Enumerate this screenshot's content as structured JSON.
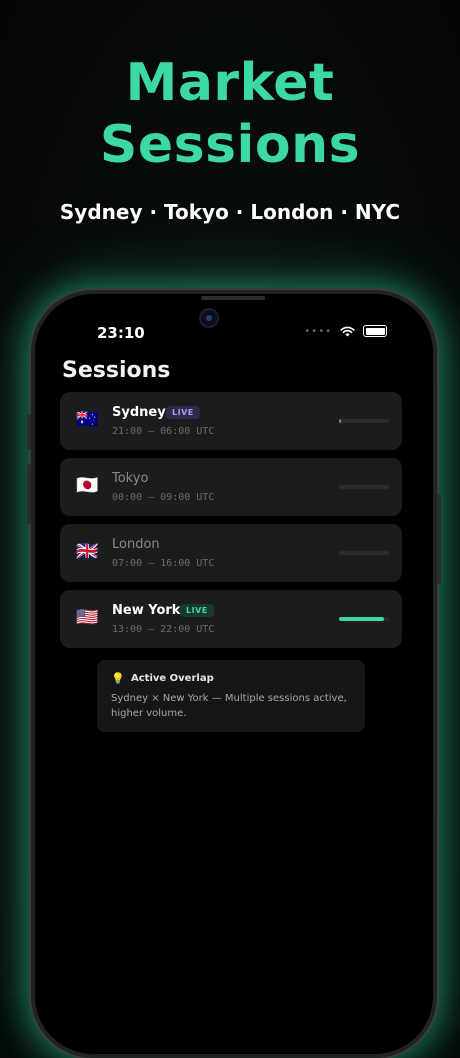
{
  "hero": {
    "title_line1": "Market",
    "title_line2": "Sessions",
    "subtitle": "Sydney · Tokyo · London · NYC"
  },
  "status_bar": {
    "time": "23:10",
    "dots": "••••"
  },
  "screen": {
    "title": "Sessions"
  },
  "sessions": [
    {
      "flag": "🇦🇺",
      "name": "Sydney",
      "hours": "21:00 — 06:00 UTC",
      "badge": "LIVE",
      "badge_color": "#a89cf0",
      "active": true,
      "progress": 0.03
    },
    {
      "flag": "🇯🇵",
      "name": "Tokyo",
      "hours": "00:00 — 09:00 UTC",
      "badge": "",
      "active": false,
      "progress": 0
    },
    {
      "flag": "🇬🇧",
      "name": "London",
      "hours": "07:00 — 16:00 UTC",
      "badge": "",
      "active": false,
      "progress": 0
    },
    {
      "flag": "🇺🇸",
      "name": "New York",
      "hours": "13:00 — 22:00 UTC",
      "badge": "LIVE",
      "badge_color": "#46d6a3",
      "active": true,
      "progress": 0.9
    }
  ],
  "overlap": {
    "icon": "lightbulb-icon",
    "title": "Active Overlap",
    "text": "Sydney × New York — Multiple sessions active, higher volume."
  },
  "colors": {
    "accent": "#3dd9a4",
    "card": "#1c1c1e"
  }
}
